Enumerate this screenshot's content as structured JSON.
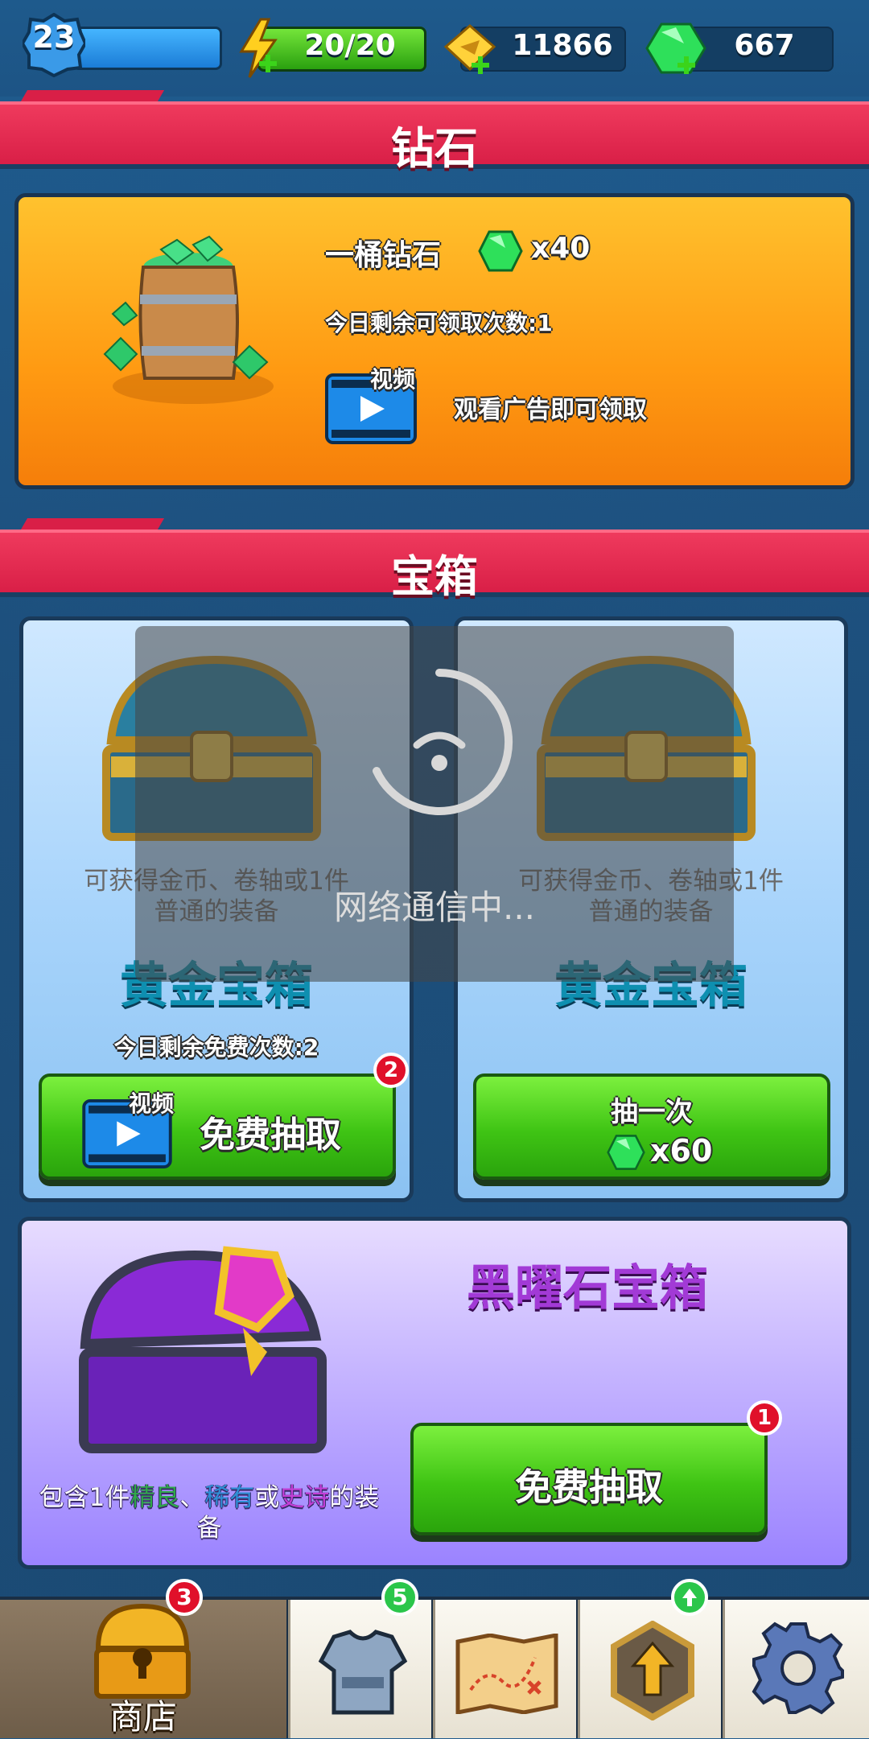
{
  "topbar": {
    "level": "23",
    "energy": "20/20",
    "gold": "11866",
    "gems": "667"
  },
  "diamond_section": {
    "title": "钻石",
    "offer_name": "一桶钻石",
    "offer_amount": "x40",
    "remaining_label": "今日剩余可领取次数:",
    "remaining_count": "1",
    "video_label": "视频",
    "watch_text": "观看广告即可领取"
  },
  "chest_section": {
    "title": "宝箱",
    "left": {
      "desc_line1": "可获得金币、卷轴或1件",
      "desc_line2": "普通的装备",
      "name": "黄金宝箱",
      "free_remaining_label": "今日剩余免费次数:",
      "free_remaining_count": "2",
      "video_label": "视频",
      "button_label": "免费抽取",
      "badge": "2"
    },
    "right": {
      "desc_line1": "可获得金币、卷轴或1件",
      "desc_line2": "普通的装备",
      "name": "黄金宝箱",
      "button_label": "抽一次",
      "button_cost": "x60"
    },
    "obsidian": {
      "name": "黑曜石宝箱",
      "desc_prefix": "包含1件",
      "desc_fine": "精良",
      "desc_sep": "、",
      "desc_rare": "稀有",
      "desc_or": "或",
      "desc_epic": "史诗",
      "desc_suffix": "的装",
      "desc_line2": "备",
      "button_label": "免费抽取",
      "badge": "1"
    }
  },
  "overlay": {
    "text": "网络通信中..."
  },
  "nav": {
    "shop_label": "商店",
    "shop_badge": "3",
    "gear_badge": "5"
  },
  "colors": {
    "section_red": "#e0264c",
    "fine": "#2fa84a",
    "rare": "#2f8fd6",
    "epic": "#c23fd6"
  }
}
